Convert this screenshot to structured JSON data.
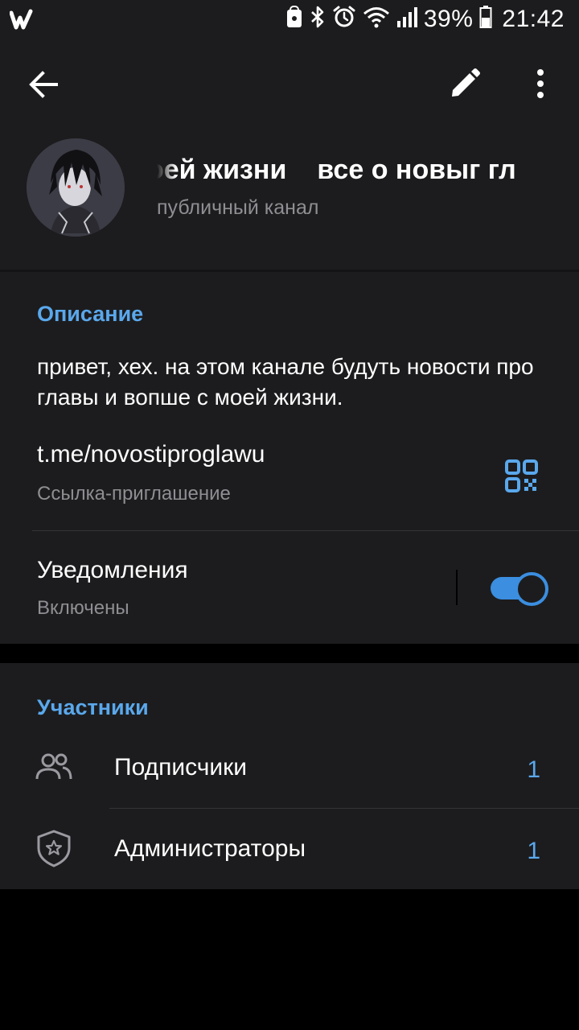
{
  "status_bar": {
    "app_icon": "wattpad-logo-icon",
    "battery_percent": "39%",
    "time": "21:42",
    "icons": [
      "lock-icon",
      "bluetooth-icon",
      "alarm-icon",
      "wifi-icon",
      "signal-icon",
      "battery-icon"
    ]
  },
  "toolbar": {
    "back_icon": "back-arrow-icon",
    "edit_icon": "pencil-icon",
    "more_icon": "more-vertical-icon"
  },
  "channel": {
    "title_part1": "оей жизни",
    "title_part2": "все о новыг гл",
    "type": "публичный канал"
  },
  "info": {
    "description_header": "Описание",
    "description": "привет, хех. на этом канале будуть новости про главы и вопше с моей жизни.",
    "link": "t.me/novostiproglawu",
    "link_caption": "Ссылка-приглашение",
    "notifications_label": "Уведомления",
    "notifications_status": "Включены",
    "notifications_enabled": true
  },
  "members": {
    "header": "Участники",
    "rows": [
      {
        "label": "Подписчики",
        "count": "1",
        "icon": "people-icon"
      },
      {
        "label": "Администраторы",
        "count": "1",
        "icon": "shield-star-icon"
      }
    ]
  },
  "colors": {
    "accent": "#5aa8ec",
    "panel": "#1c1c1e",
    "secondary_text": "#8e8e93"
  }
}
